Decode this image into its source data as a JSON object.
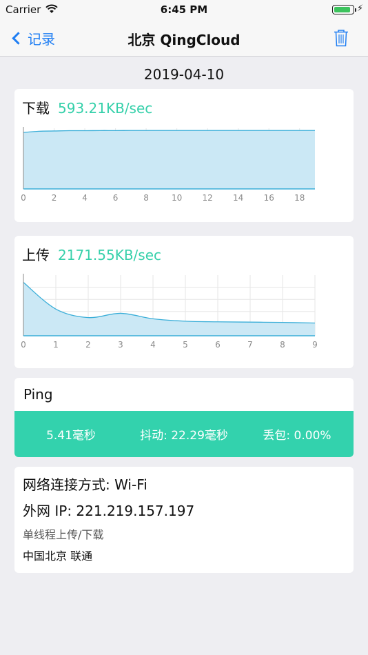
{
  "status_bar": {
    "carrier": "Carrier",
    "time": "6:45 PM",
    "wifi_icon": "wifi-icon",
    "battery_icon": "battery-icon",
    "battery_level": 0.9,
    "charging_icon": "charging-bolt-icon"
  },
  "nav": {
    "back_label": "记录",
    "title": "北京 QingCloud",
    "trash_icon": "trash-icon",
    "accent_color": "#1f7ef3"
  },
  "date": "2019-04-10",
  "download": {
    "label": "下载",
    "speed": "593.21KB/sec"
  },
  "upload": {
    "label": "上传",
    "speed": "2171.55KB/sec"
  },
  "ping": {
    "title": "Ping",
    "latency": "5.41毫秒",
    "jitter": "抖动: 22.29毫秒",
    "loss": "丢包: 0.00%",
    "band_color": "#33d2ad"
  },
  "info": {
    "network": "网络连接方式: Wi-Fi",
    "ip": "外网 IP: 221.219.157.197",
    "mode": "单线程上传/下载",
    "location": "中国北京 联通"
  },
  "chart_data": [
    {
      "type": "area",
      "title": "下载",
      "x": [
        0,
        1,
        2,
        3,
        4,
        5,
        6,
        7,
        8,
        9,
        10,
        11,
        12,
        13,
        14,
        15,
        16,
        17,
        18,
        19
      ],
      "values": [
        0.93,
        0.95,
        0.955,
        0.96,
        0.96,
        0.962,
        0.962,
        0.963,
        0.963,
        0.963,
        0.963,
        0.963,
        0.963,
        0.963,
        0.963,
        0.963,
        0.963,
        0.963,
        0.963,
        0.963
      ],
      "x_ticks": [
        "0",
        "2",
        "4",
        "6",
        "8",
        "10",
        "12",
        "14",
        "16",
        "18"
      ],
      "xlim": [
        0,
        19
      ],
      "ylim": [
        0,
        1
      ],
      "grid": true,
      "color": "#3aaed8",
      "fill": "#cbe8f5"
    },
    {
      "type": "area",
      "title": "上传",
      "x": [
        0,
        1,
        2,
        3,
        4,
        5,
        6,
        7,
        8,
        9
      ],
      "values": [
        0.88,
        0.44,
        0.3,
        0.37,
        0.28,
        0.24,
        0.23,
        0.225,
        0.22,
        0.21
      ],
      "x_ticks": [
        "0",
        "1",
        "2",
        "3",
        "4",
        "5",
        "6",
        "7",
        "8",
        "9"
      ],
      "xlim": [
        0,
        9
      ],
      "ylim": [
        0,
        1
      ],
      "grid": true,
      "color": "#3aaed8",
      "fill": "#cbe8f5"
    }
  ]
}
